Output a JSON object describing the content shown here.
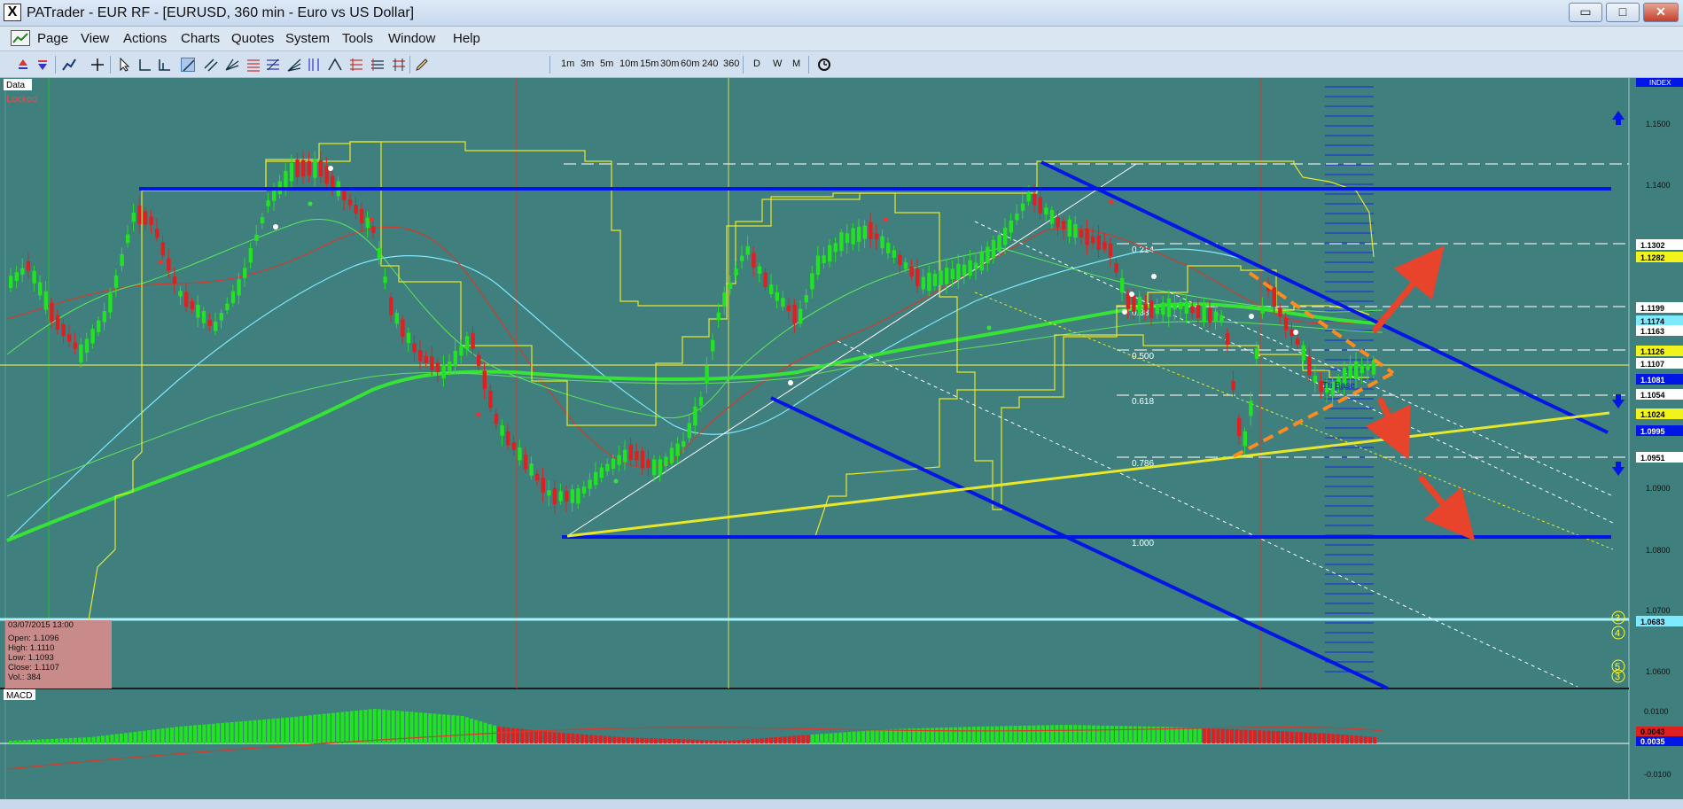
{
  "window": {
    "app_icon": "X",
    "title": "PATrader - EUR RF - [EURUSD, 360 min - Euro vs US Dollar]",
    "minimize": "▭",
    "restore": "□",
    "close": "✕",
    "mdi_minimize": "–",
    "mdi_restore": "⧉",
    "mdi_close": "×"
  },
  "menu": {
    "items": [
      "Page",
      "View",
      "Actions",
      "Charts",
      "Quotes",
      "System",
      "Tools",
      "Window",
      "Help"
    ]
  },
  "toolbar": {
    "timeframes": [
      "1m",
      "3m",
      "5m",
      "10m",
      "15m",
      "30m",
      "60m",
      "240",
      "360"
    ],
    "periods": [
      "D",
      "W",
      "M"
    ]
  },
  "colors": {
    "chart_bg": "#3f7f7d",
    "trend_blue": "#0016e6",
    "yellow": "#f2f21c",
    "bull": "#22e322",
    "bear": "#e02020",
    "cyan_line": "#7fe9ff",
    "orange": "#ff8a1e",
    "arrow_red": "#e8432b"
  },
  "chart": {
    "data_tab": "Data",
    "locked_label": "Locked",
    "index_label": "INDEX",
    "fib_labels": [
      "0.214",
      "0.382",
      "0.500",
      "0.618",
      "0.786",
      "1.000"
    ],
    "pattern_label": "Tri Base",
    "counts": [
      "3",
      "4",
      "5",
      "3"
    ],
    "price_ticks": [
      "1.1500",
      "1.1400",
      "1.0900",
      "1.0800",
      "1.0700",
      "1.0600"
    ],
    "price_tags": [
      {
        "text": "1.1302",
        "bg": "#ffffff",
        "fg": "#000000"
      },
      {
        "text": "1.1282",
        "bg": "#f2f21c",
        "fg": "#000000"
      },
      {
        "text": "1.1199",
        "bg": "#ffffff",
        "fg": "#000000"
      },
      {
        "text": "1.1174",
        "bg": "#7fe9ff",
        "fg": "#000000"
      },
      {
        "text": "1.1163",
        "bg": "#ffffff",
        "fg": "#000000"
      },
      {
        "text": "1.1126",
        "bg": "#f2f21c",
        "fg": "#000000"
      },
      {
        "text": "1.1107",
        "bg": "#ffffff",
        "fg": "#000000"
      },
      {
        "text": "1.1081",
        "bg": "#0016e6",
        "fg": "#ffffff"
      },
      {
        "text": "1.1054",
        "bg": "#ffffff",
        "fg": "#000000"
      },
      {
        "text": "1.1024",
        "bg": "#f2f21c",
        "fg": "#000000"
      },
      {
        "text": "1.0995",
        "bg": "#0016e6",
        "fg": "#ffffff"
      },
      {
        "text": "1.0951",
        "bg": "#ffffff",
        "fg": "#000000"
      },
      {
        "text": "1.0683",
        "bg": "#7fe9ff",
        "fg": "#000000"
      }
    ],
    "ohlc": {
      "datetime": "03/07/2015 13:00",
      "open": "Open: 1.1096",
      "high": "High: 1.1110",
      "low": "Low: 1.1093",
      "close": "Close: 1.1107",
      "volume": "Vol.: 384"
    }
  },
  "macd": {
    "label": "MACD",
    "ticks": [
      "0.0100",
      "0.0000",
      "-0.0100"
    ],
    "tags": [
      {
        "text": "0.0043",
        "bg": "#e02020",
        "fg": "#000000"
      },
      {
        "text": "0.0035",
        "bg": "#0016e6",
        "fg": "#ffffff"
      }
    ]
  }
}
